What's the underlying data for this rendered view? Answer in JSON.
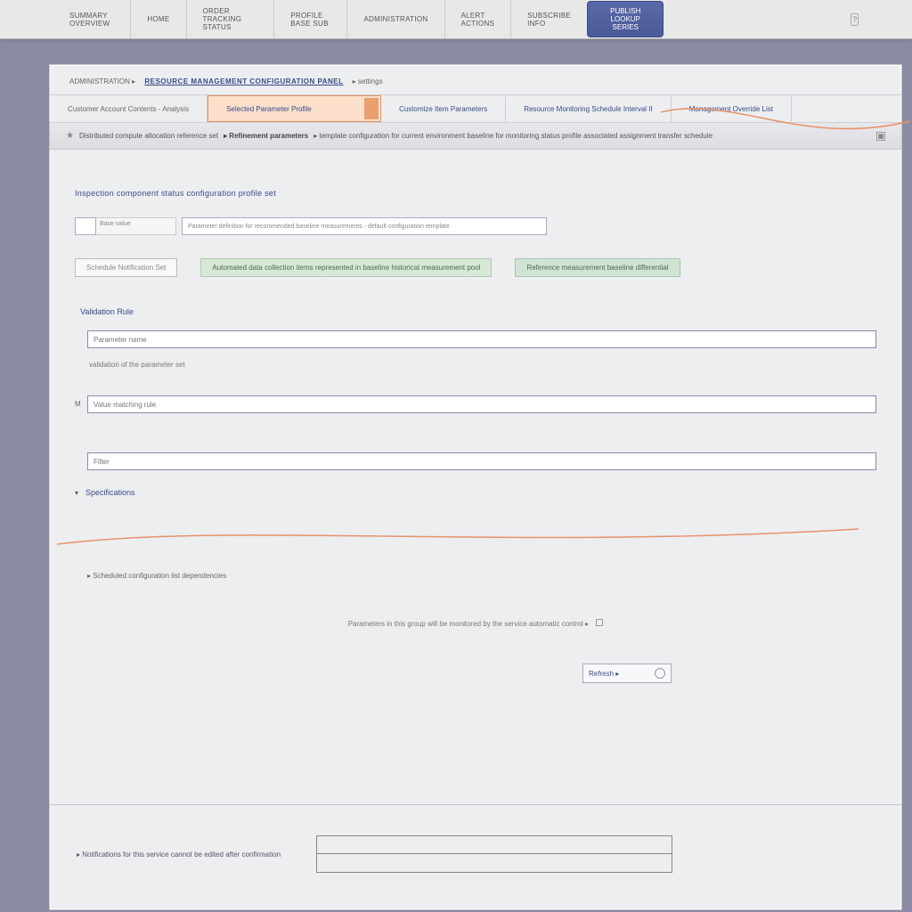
{
  "topnav": {
    "items": [
      "SUMMARY OVERVIEW",
      "HOME",
      "ORDER TRACKING STATUS",
      "PROFILE BASE SUB",
      "ADMINISTRATION",
      "ALERT ACTIONS",
      "SUBSCRIBE INFO"
    ],
    "action_button": "PUBLISH LOOKUP SERIES",
    "help_glyph": "?"
  },
  "breadcrumb": {
    "prefix": "ADMINISTRATION  ▸",
    "link": "RESOURCE MANAGEMENT CONFIGURATION PANEL",
    "suffix": "▸  settings"
  },
  "tabs": {
    "label": "Customer Account Contents - Analysis",
    "highlighted": "Selected Parameter Profile",
    "items": [
      "Customize Item Parameters",
      "Resource Monitoring Schedule Interval II",
      "Management Override List"
    ]
  },
  "toolbar": {
    "star": "★",
    "text_prefix": "Distributed compute allocation reference set",
    "text_bold": "▸  Refinement parameters",
    "text_rest": "▸ template configuration for current environment baseline for monitoring status profile associated assignment transfer schedule",
    "icon_glyph": "▦"
  },
  "content": {
    "section_title": "Inspection component status configuration profile set",
    "info_row": {
      "label": "Base value",
      "long_text": "Parameter definition for recommended baseline measurements - default configuration template"
    },
    "pills": {
      "p1": "Schedule Notification Set",
      "p2": "Automated data collection items represented in baseline historical measurement pool",
      "p3": "Reference measurement baseline differential"
    },
    "form_label": "Validation Rule",
    "field1": {
      "marker": "",
      "placeholder": "Parameter name",
      "helper": "validation of the parameter set"
    },
    "field2": {
      "marker": "M",
      "placeholder": "Value matching rule"
    },
    "field3": {
      "marker": "",
      "placeholder": "Filter"
    },
    "collapse_label": "Specifications",
    "note_line": "▸  Scheduled configuration list dependencies",
    "centered_note": "Parameters in this group will be monitored by the service automatic control  ▸",
    "small_control_label": "Refresh ▸"
  },
  "footer": {
    "label": "▸ Notifications for this service cannot be edited after confirmation"
  }
}
